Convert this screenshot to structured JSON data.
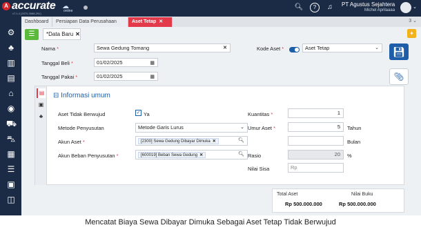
{
  "app": {
    "logo_text": "accurate",
    "logo_sub": "online",
    "version": "v7.1.4 (2070-3988-291)",
    "company": "PT Agustus Sejahtera",
    "user": "Michel Aprilaaaa"
  },
  "tabs": [
    {
      "label": "Dashboard",
      "active": false
    },
    {
      "label": "Persiapan Data Perusahaan",
      "active": false
    },
    {
      "label": "Aset Tetap",
      "active": true
    }
  ],
  "tabs_count": "3",
  "doc_tab": {
    "label": "Data Baru",
    "modified": "*"
  },
  "form": {
    "nama": {
      "label": "Nama",
      "value": "Sewa Gedung Tomang"
    },
    "tanggal_beli": {
      "label": "Tanggal Beli",
      "value": "01/02/2025"
    },
    "tanggal_pakai": {
      "label": "Tanggal Pakai",
      "value": "01/02/2025"
    },
    "kode_aset": {
      "label": "Kode Aset",
      "value": "Aset Tetap"
    }
  },
  "info": {
    "title": "Informasi umum",
    "aset_tidak_berwujud": {
      "label": "Aset Tidak Berwujud",
      "checkbox_label": "Ya",
      "checked": true
    },
    "metode_penyusutan": {
      "label": "Metode Penyusutan",
      "value": "Metode Garis Lurus"
    },
    "akun_aset": {
      "label": "Akun Aset",
      "chip": "[2300] Sewa Gedung Dibayar Dimuka"
    },
    "akun_beban": {
      "label": "Akun Beban Penyusutan",
      "chip": "[600019] Beban Sewa Gedung"
    },
    "kuantitas": {
      "label": "Kuantitas",
      "value": "1"
    },
    "umur_aset": {
      "label": "Umur Aset",
      "value": "5",
      "unit_tahun": "Tahun",
      "unit_bulan": "Bulan"
    },
    "rasio": {
      "label": "Rasio",
      "value": "20",
      "unit": "%"
    },
    "nilai_sisa": {
      "label": "Nilai Sisa",
      "prefix": "Rp"
    }
  },
  "totals": {
    "total_aset_label": "Total Aset",
    "total_aset_value": "Rp 500.000.000",
    "nilai_buku_label": "Nilai Buku",
    "nilai_buku_value": "Rp 500.000.000"
  },
  "caption": "Mencatat Biaya Sewa Dibayar Dimuka Sebagai Aset Tetap Tidak Berwujud"
}
